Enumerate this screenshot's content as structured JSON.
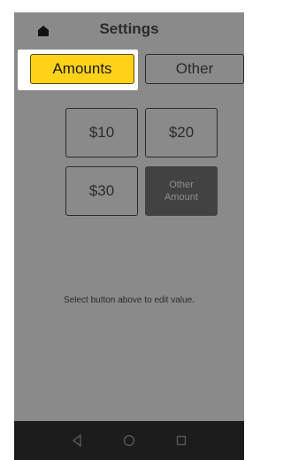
{
  "header": {
    "title": "Settings",
    "home_icon": "home-icon"
  },
  "tabs": [
    {
      "label": "Amounts",
      "active": true
    },
    {
      "label": "Other",
      "active": false
    }
  ],
  "amounts": [
    {
      "label": "$10"
    },
    {
      "label": "$20"
    },
    {
      "label": "$30"
    },
    {
      "label_line1": "Other",
      "label_line2": "Amount",
      "selected": true
    }
  ],
  "hint": "Select button above to edit value.",
  "navbar": {
    "back_icon": "back-triangle-icon",
    "home_icon": "home-circle-icon",
    "recents_icon": "recents-square-icon"
  },
  "colors": {
    "accent": "#ffd21a",
    "screen_bg": "#8a8a8a",
    "selected_bg": "#424242",
    "navbar_bg": "#1c1c1c"
  }
}
